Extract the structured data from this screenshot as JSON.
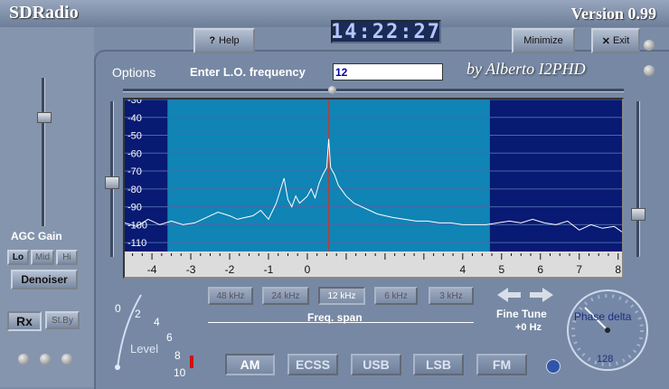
{
  "app": {
    "title": "SDRadio",
    "version": "Version 0.99",
    "author": "by Alberto I2PHD"
  },
  "toolbar": {
    "help_label": "Help",
    "help_icon": "?",
    "minimize_label": "Minimize",
    "exit_label": "Exit",
    "exit_icon": "✕",
    "clock": "14:22:27"
  },
  "lo": {
    "options_label": "Options",
    "label": "Enter L.O. frequency",
    "value": "12"
  },
  "left": {
    "agc_label": "AGC Gain",
    "agc_buttons": [
      "Lo",
      "Mid",
      "Hi"
    ],
    "denoiser_label": "Denoiser",
    "rx_label": "Rx",
    "standby_label": "St.By"
  },
  "span": {
    "buttons": [
      "48 kHz",
      "24 kHz",
      "12 kHz",
      "6 kHz",
      "3 kHz"
    ],
    "active": "12 kHz",
    "label": "Freq. span"
  },
  "tune": {
    "label": "Fine Tune",
    "value": "+0 Hz"
  },
  "level": {
    "label": "Level",
    "ticks": [
      "0",
      "2",
      "4",
      "6",
      "8",
      "10"
    ]
  },
  "modes": {
    "buttons": [
      "AM",
      "ECSS",
      "USB",
      "LSB",
      "FM"
    ],
    "active": "AM"
  },
  "phase": {
    "label": "Phase delta",
    "value": "128"
  },
  "chart_data": {
    "type": "line",
    "y_ticks": [
      "-30",
      "-40",
      "-50",
      "-60",
      "-70",
      "-80",
      "-90",
      "-100",
      "-110"
    ],
    "ylim": [
      -115,
      -30
    ],
    "x_ticks": [
      "-4",
      "-3",
      "-2",
      "-1",
      "0",
      "4",
      "5",
      "6",
      "7",
      "8"
    ],
    "xlim": [
      -4.7,
      8.1
    ],
    "passband": [
      -3.6,
      4.7
    ],
    "marker_x": 0.55,
    "colors": {
      "outside": "#081a73",
      "passband": "#0f84b5",
      "trace": "#ffffff",
      "grid": "#4a67a8",
      "marker": "#c0392b"
    },
    "x": [
      -4.7,
      -4.4,
      -4.1,
      -3.8,
      -3.5,
      -3.2,
      -2.9,
      -2.6,
      -2.3,
      -2.0,
      -1.8,
      -1.6,
      -1.4,
      -1.2,
      -1.0,
      -0.8,
      -0.6,
      -0.5,
      -0.4,
      -0.3,
      -0.2,
      -0.1,
      0.0,
      0.1,
      0.2,
      0.3,
      0.4,
      0.5,
      0.55,
      0.6,
      0.7,
      0.8,
      0.9,
      1.0,
      1.2,
      1.4,
      1.6,
      1.8,
      2.0,
      2.2,
      2.5,
      2.8,
      3.1,
      3.4,
      3.7,
      4.0,
      4.3,
      4.6,
      4.9,
      5.2,
      5.5,
      5.8,
      6.1,
      6.4,
      6.7,
      7.0,
      7.3,
      7.6,
      7.9,
      8.1
    ],
    "y": [
      -99,
      -101,
      -97,
      -100,
      -98,
      -100,
      -99,
      -96,
      -93,
      -95,
      -97,
      -96,
      -95,
      -92,
      -97,
      -88,
      -74,
      -86,
      -90,
      -84,
      -88,
      -86,
      -84,
      -80,
      -85,
      -77,
      -72,
      -68,
      -52,
      -68,
      -72,
      -78,
      -81,
      -84,
      -88,
      -90,
      -92,
      -94,
      -95,
      -96,
      -97,
      -98,
      -98,
      -99,
      -99,
      -100,
      -100,
      -100,
      -99,
      -98,
      -99,
      -97,
      -99,
      -100,
      -98,
      -103,
      -100,
      -102,
      -101,
      -104
    ]
  }
}
